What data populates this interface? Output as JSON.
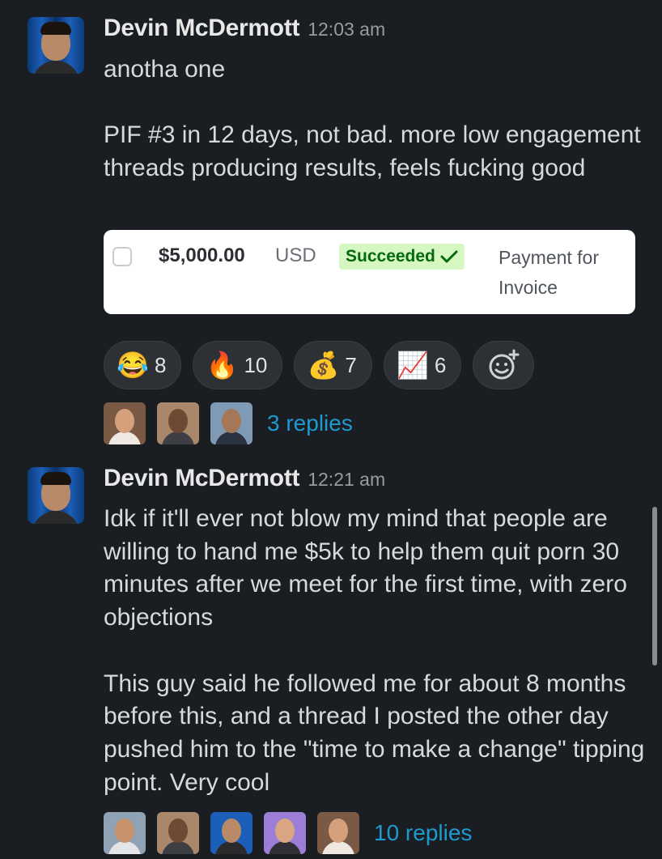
{
  "messages": [
    {
      "author": "Devin McDermott",
      "time": "12:03 am",
      "text": "anotha one\n\nPIF #3 in 12 days, not bad. more low engagement threads producing results, feels fucking good",
      "attachment": {
        "amount": "$5,000.00",
        "currency": "USD",
        "status": "Succeeded",
        "status_icon": "check-icon",
        "description": "Payment for Invoice"
      },
      "reactions": [
        {
          "icon": "laughing-emoji",
          "glyph": "😂",
          "count": "8"
        },
        {
          "icon": "fire-emoji",
          "glyph": "🔥",
          "count": "10"
        },
        {
          "icon": "money-bag-emoji",
          "glyph": "💰",
          "count": "7"
        },
        {
          "icon": "chart-increasing-emoji",
          "glyph": "📈",
          "count": "6"
        }
      ],
      "add_reaction_icon": "add-reaction-icon",
      "thread": {
        "replies": "3 replies",
        "participants": 3
      }
    },
    {
      "author": "Devin McDermott",
      "time": "12:21 am",
      "text": "Idk if it'll ever not blow my mind that people are willing to hand me $5k to help them quit porn 30 minutes after we meet for the first time, with zero objections\n\nThis guy said he followed me for about 8 months before this, and a thread I posted the other day pushed him to the \"time to make a change\" tipping point. Very cool",
      "thread": {
        "replies": "10 replies",
        "participants": 5
      }
    }
  ],
  "colors": {
    "background": "#1a1d21",
    "link": "#1d9bd1",
    "status_bg": "#d7f7c2",
    "status_text": "#05690d"
  }
}
